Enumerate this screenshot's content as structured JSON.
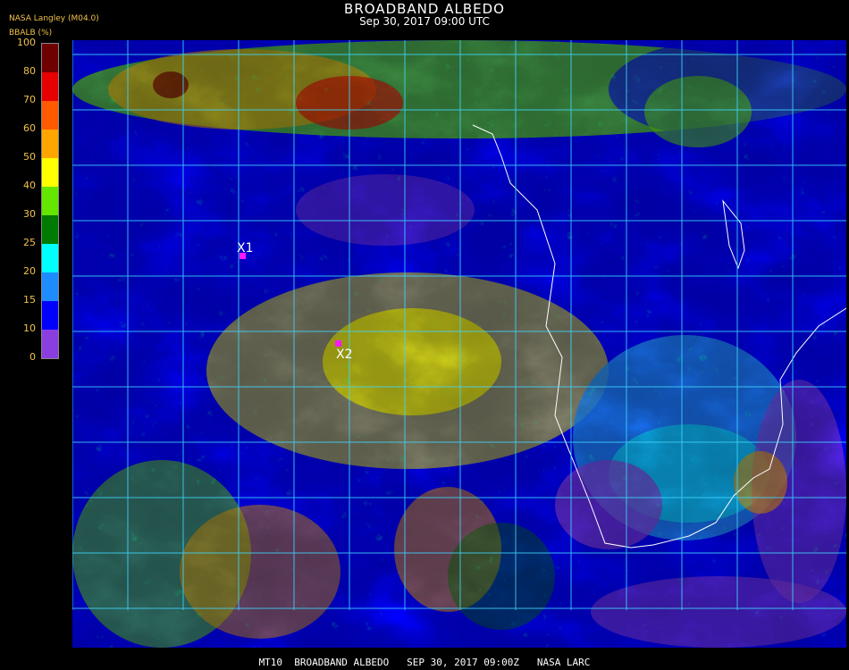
{
  "header": {
    "title": "BROADBAND ALBEDO",
    "datetime": "Sep 30, 2017 09:00 UTC",
    "source": "NASA Langley (M04.0)"
  },
  "legend": {
    "unit_label": "BBALB (%)",
    "ticks": [
      "100",
      "80",
      "70",
      "60",
      "50",
      "40",
      "30",
      "25",
      "20",
      "15",
      "10",
      "0"
    ],
    "bands": [
      {
        "from": 0,
        "to": 10,
        "color": "#8a3ee0"
      },
      {
        "from": 10,
        "to": 15,
        "color": "#0000ff"
      },
      {
        "from": 15,
        "to": 20,
        "color": "#1e8cff"
      },
      {
        "from": 20,
        "to": 25,
        "color": "#00ffff"
      },
      {
        "from": 25,
        "to": 30,
        "color": "#007a00"
      },
      {
        "from": 30,
        "to": 40,
        "color": "#64e600"
      },
      {
        "from": 40,
        "to": 50,
        "color": "#ffff00"
      },
      {
        "from": 50,
        "to": 60,
        "color": "#ffa500"
      },
      {
        "from": 60,
        "to": 70,
        "color": "#ff5a00"
      },
      {
        "from": 70,
        "to": 80,
        "color": "#e60000"
      },
      {
        "from": 80,
        "to": 100,
        "color": "#6e0000"
      }
    ]
  },
  "markers": [
    {
      "label": "X1"
    },
    {
      "label": "X2"
    }
  ],
  "footer": {
    "text": "MT10  BROADBAND ALBEDO   SEP 30, 2017 09:00Z   NASA LARC"
  }
}
